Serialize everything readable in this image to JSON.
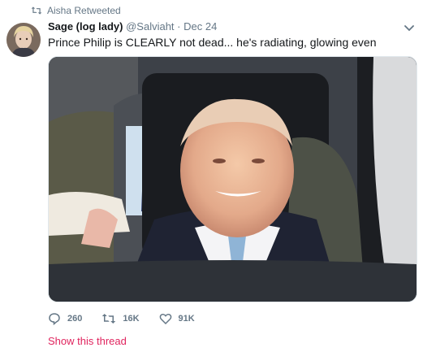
{
  "retweet": {
    "icon": "retweet-icon",
    "text": "Aisha Retweeted"
  },
  "author": {
    "display_name": "Sage (log lady)",
    "handle": "@Salviaht",
    "separator": "·",
    "date": "Dec 24"
  },
  "tweet": {
    "text": "Prince Philip is CLEARLY not dead... he's radiating, glowing even"
  },
  "actions": {
    "reply": {
      "icon": "reply-icon",
      "count": "260"
    },
    "retweet": {
      "icon": "retweet-icon",
      "count": "16K"
    },
    "like": {
      "icon": "heart-icon",
      "count": "91K"
    }
  },
  "thread_link": "Show this thread",
  "colors": {
    "link_red": "#e0245e",
    "muted": "#657786",
    "text": "#14171a"
  }
}
